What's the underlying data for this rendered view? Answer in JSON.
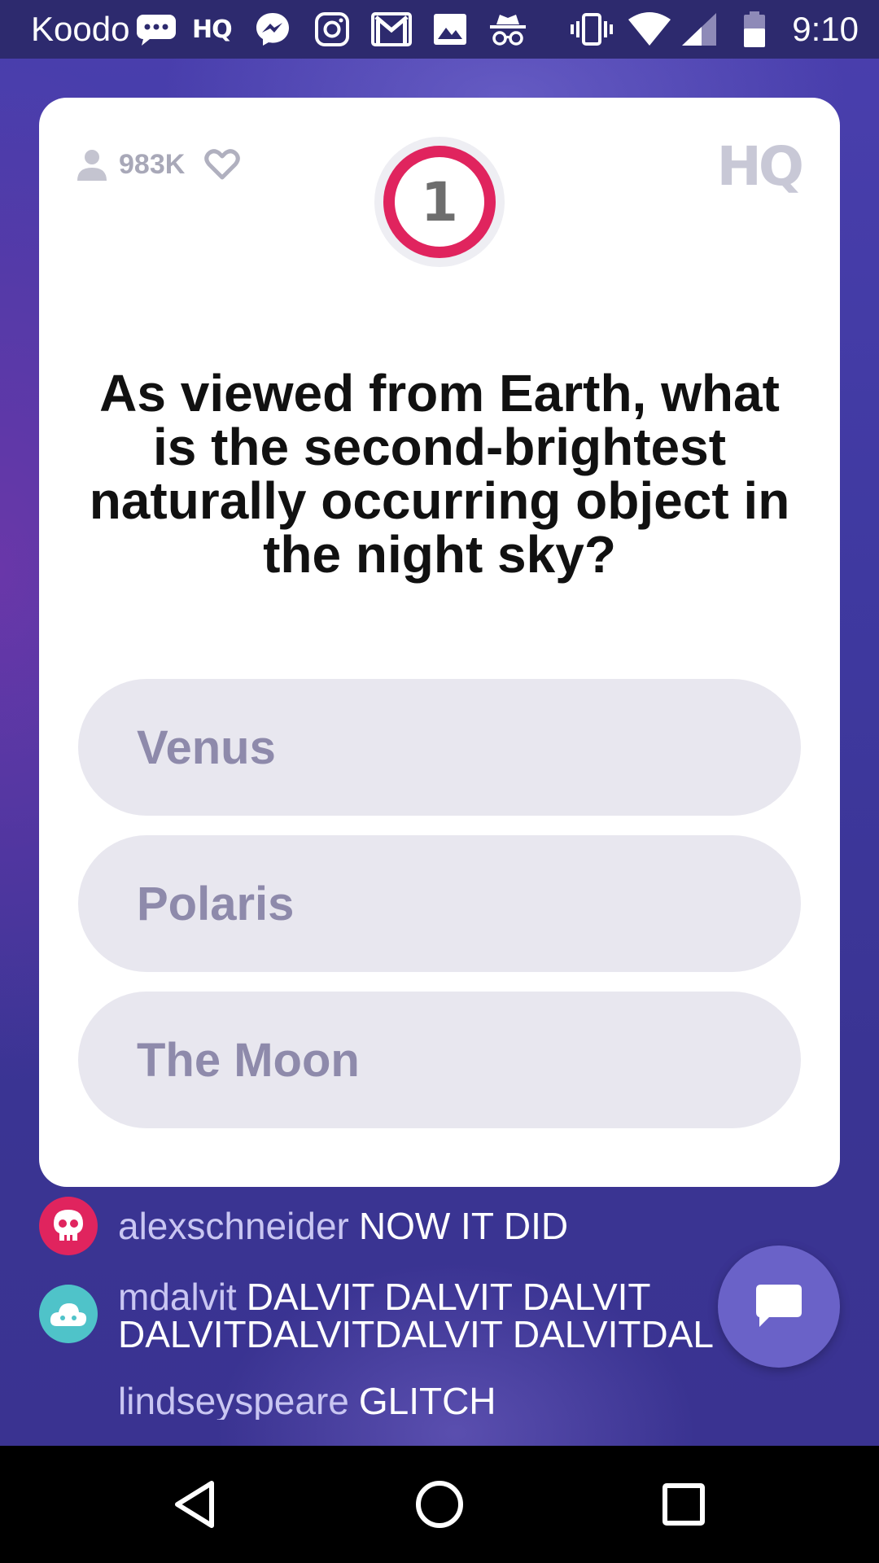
{
  "status_bar": {
    "carrier": "Koodo",
    "hq_label": "HQ",
    "time": "9:10",
    "icons": [
      "chat-bubble-icon",
      "hq-app-icon",
      "messenger-icon",
      "instagram-icon",
      "gmail-icon",
      "gallery-icon",
      "incognito-icon",
      "vibrate-icon",
      "wifi-icon",
      "cell-signal-icon",
      "battery-icon"
    ]
  },
  "game": {
    "viewer_count": "983K",
    "timer_number": "1",
    "logo": "HQ",
    "question": "As viewed from Earth, what is the second-brightest naturally occurring object in the night sky?",
    "answers": [
      {
        "label": "Venus"
      },
      {
        "label": "Polaris"
      },
      {
        "label": "The Moon"
      }
    ]
  },
  "chat": {
    "messages": [
      {
        "user": "alexschneider",
        "text": "NOW IT DID",
        "avatar_color": "#e0245e"
      },
      {
        "user": "mdalvit",
        "text": "DALVIT DALVIT DALVIT",
        "text2": "DALVITDALVITDALVIT DALVITDAL",
        "avatar_color": "#4fc3c9"
      },
      {
        "user": "lindseyspeare",
        "text": "GLITCH"
      }
    ]
  },
  "colors": {
    "accent_pink": "#e0245e",
    "background_purple": "#3f39a0",
    "answer_bg": "#e8e7ef",
    "answer_text": "#8e8aab"
  },
  "nav": {
    "icons": [
      "back-icon",
      "home-icon",
      "recents-icon"
    ]
  }
}
